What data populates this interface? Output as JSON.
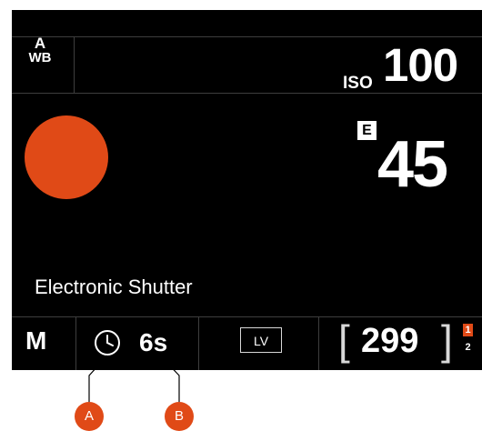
{
  "status": {
    "white_balance": {
      "line1": "A",
      "line2": "WB",
      "icon": "auto-white-balance-icon"
    },
    "iso": {
      "label": "ISO",
      "value": "100"
    },
    "exposure": {
      "badge": "E",
      "value": "45"
    },
    "record_indicator": {
      "color": "#e04a17"
    },
    "shutter_mode": "Electronic Shutter"
  },
  "bottom_bar": {
    "mode": "M",
    "self_timer": {
      "icon": "self-timer-icon",
      "value": "6s"
    },
    "live_view": "LV",
    "bracket_left": "[",
    "shots_remaining": "299",
    "bracket_right": "]",
    "card_slots": {
      "active": "1",
      "inactive": "2"
    }
  },
  "callouts": [
    {
      "label": "A"
    },
    {
      "label": "B"
    }
  ],
  "colors": {
    "accent": "#e04a17",
    "background": "#000000",
    "divider": "#3e3e3e"
  }
}
